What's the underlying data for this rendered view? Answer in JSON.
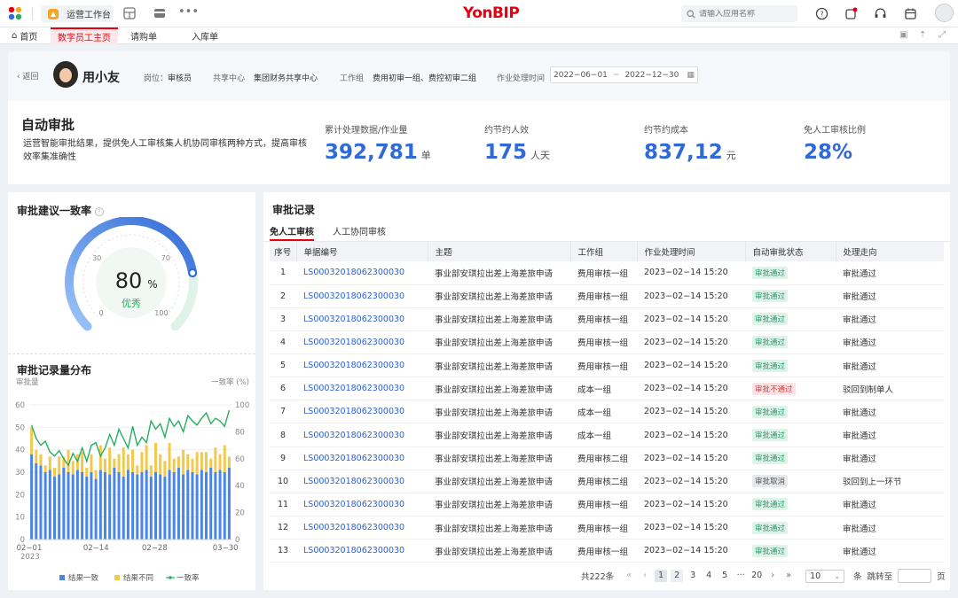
{
  "topbar": {
    "workspace_label": "运营工作台",
    "brand": "YonBIP",
    "search_placeholder": "请输入应用名称",
    "colors": {
      "brand": "#e60012",
      "accent": "#2f6ad6"
    }
  },
  "tabs": [
    {
      "label": "首页",
      "icon": "home-icon"
    },
    {
      "label": "数字员工主页",
      "active": true
    },
    {
      "label": "请购单"
    },
    {
      "label": "入库单"
    }
  ],
  "profile": {
    "back_label": "返回",
    "name": "用小友",
    "post_label": "岗位：",
    "post_value": "审核员",
    "center_label": "共享中心",
    "center_value": "集团财务共享中心",
    "group_label": "工作组",
    "group_value": "费用初审一组、费控初审二组",
    "time_label": "作业处理时间",
    "date_from": "2022−06−01",
    "date_to": "2022−12−30"
  },
  "kpi": {
    "title": "自动审批",
    "description": "运营智能审批结果，提供免人工审核集人机协同审核两种方式，提高审核效率集准确性",
    "items": [
      {
        "label": "累计处理数据/作业量",
        "value": "392,781",
        "unit": "单"
      },
      {
        "label": "约节约人效",
        "value": "175",
        "unit": "人天"
      },
      {
        "label": "约节约成本",
        "value": "837,12",
        "unit": "元"
      },
      {
        "label": "免人工审核比例",
        "value": "28%",
        "unit": ""
      }
    ]
  },
  "gauge": {
    "title": "审批建议一致率",
    "value": "80",
    "percent_sign": "%",
    "rating": "优秀",
    "level": 0.8,
    "ticks": [
      "0",
      "30",
      "70",
      "100"
    ]
  },
  "chart_data": {
    "type": "bar",
    "title": "审批记录量分布",
    "ylabel": "审批量",
    "y2label": "一致率",
    "y2unit": "(%)",
    "ylim": [
      0,
      60
    ],
    "y2lim": [
      0,
      100
    ],
    "yticks": [
      "0",
      "10",
      "20",
      "30",
      "40",
      "50",
      "60"
    ],
    "y2ticks": [
      "0",
      "20",
      "40",
      "60",
      "80",
      "100"
    ],
    "x_tick_labels": [
      "02−01",
      "02−14",
      "02−28",
      "03−30"
    ],
    "x_year": "2023",
    "stacked": true,
    "series": [
      {
        "name": "结果一致",
        "kind": "bar",
        "color": "#4a86e8",
        "values": [
          38,
          34,
          33,
          30,
          31,
          28,
          29,
          32,
          30,
          29,
          31,
          30,
          28,
          30,
          27,
          31,
          30,
          29,
          32,
          30,
          28,
          31,
          30,
          29,
          30,
          31,
          28,
          30,
          29,
          28,
          31,
          30,
          32,
          29,
          31,
          30,
          29,
          31,
          30,
          32,
          30,
          31,
          30,
          32
        ]
      },
      {
        "name": "结果不同",
        "kind": "bar",
        "color": "#f2c94c",
        "values": [
          12,
          6,
          5,
          3,
          6,
          4,
          8,
          5,
          10,
          6,
          7,
          9,
          4,
          8,
          4,
          11,
          6,
          12,
          4,
          8,
          13,
          7,
          10,
          4,
          9,
          11,
          5,
          13,
          9,
          7,
          12,
          6,
          5,
          11,
          7,
          6,
          10,
          8,
          9,
          4,
          11,
          7,
          12,
          5
        ]
      },
      {
        "name": "一致率",
        "kind": "line",
        "color": "#27ae60",
        "values": [
          85,
          75,
          70,
          73,
          65,
          62,
          66,
          60,
          55,
          64,
          58,
          68,
          58,
          70,
          72,
          62,
          68,
          78,
          70,
          82,
          75,
          68,
          84,
          70,
          76,
          72,
          88,
          82,
          86,
          76,
          90,
          84,
          88,
          80,
          92,
          88,
          85,
          90,
          94,
          86,
          90,
          88,
          84,
          96
        ]
      }
    ],
    "legend_position": "bottom"
  },
  "records": {
    "title": "审批记录",
    "subtabs": [
      "免人工审核",
      "人工协同审核"
    ],
    "columns": [
      "序号",
      "单据编号",
      "主题",
      "工作组",
      "作业处理时间",
      "自动审批状态",
      "处理走向"
    ],
    "rows": [
      {
        "idx": "1",
        "code": "LS00032018062300030",
        "subject": "事业部安琪拉出差上海差旅申请",
        "group": "费用审核一组",
        "time": "2023−02−14 15:20",
        "status": "审批通过",
        "status_type": "pass",
        "flow": "审批通过"
      },
      {
        "idx": "2",
        "code": "LS00032018062300030",
        "subject": "事业部安琪拉出差上海差旅申请",
        "group": "费用审核一组",
        "time": "2023−02−14 15:20",
        "status": "审批通过",
        "status_type": "pass",
        "flow": "审批通过"
      },
      {
        "idx": "3",
        "code": "LS00032018062300030",
        "subject": "事业部安琪拉出差上海差旅申请",
        "group": "费用审核一组",
        "time": "2023−02−14 15:20",
        "status": "审批通过",
        "status_type": "pass",
        "flow": "审批通过"
      },
      {
        "idx": "4",
        "code": "LS00032018062300030",
        "subject": "事业部安琪拉出差上海差旅申请",
        "group": "费用审核一组",
        "time": "2023−02−14 15:20",
        "status": "审批通过",
        "status_type": "pass",
        "flow": "审批通过"
      },
      {
        "idx": "5",
        "code": "LS00032018062300030",
        "subject": "事业部安琪拉出差上海差旅申请",
        "group": "费用审核一组",
        "time": "2023−02−14 15:20",
        "status": "审批通过",
        "status_type": "pass",
        "flow": "审批通过"
      },
      {
        "idx": "6",
        "code": "LS00032018062300030",
        "subject": "事业部安琪拉出差上海差旅申请",
        "group": "成本一组",
        "time": "2023−02−14 15:20",
        "status": "审批不通过",
        "status_type": "fail",
        "flow": "驳回到制单人"
      },
      {
        "idx": "7",
        "code": "LS00032018062300030",
        "subject": "事业部安琪拉出差上海差旅申请",
        "group": "成本一组",
        "time": "2023−02−14 15:20",
        "status": "审批通过",
        "status_type": "pass",
        "flow": "审批通过"
      },
      {
        "idx": "8",
        "code": "LS00032018062300030",
        "subject": "事业部安琪拉出差上海差旅申请",
        "group": "成本一组",
        "time": "2023−02−14 15:20",
        "status": "审批通过",
        "status_type": "pass",
        "flow": "审批通过"
      },
      {
        "idx": "9",
        "code": "LS00032018062300030",
        "subject": "事业部安琪拉出差上海差旅申请",
        "group": "费用审核二组",
        "time": "2023−02−14 15:20",
        "status": "审批通过",
        "status_type": "pass",
        "flow": "审批通过"
      },
      {
        "idx": "10",
        "code": "LS00032018062300030",
        "subject": "事业部安琪拉出差上海差旅申请",
        "group": "费用审核二组",
        "time": "2023−02−14 15:20",
        "status": "审批取消",
        "status_type": "cancel",
        "flow": "驳回到上一环节"
      },
      {
        "idx": "11",
        "code": "LS00032018062300030",
        "subject": "事业部安琪拉出差上海差旅申请",
        "group": "费用审核一组",
        "time": "2023−02−14 15:20",
        "status": "审批通过",
        "status_type": "pass",
        "flow": "审批通过"
      },
      {
        "idx": "12",
        "code": "LS00032018062300030",
        "subject": "事业部安琪拉出差上海差旅申请",
        "group": "费用审核一组",
        "time": "2023−02−14 15:20",
        "status": "审批通过",
        "status_type": "pass",
        "flow": "审批通过"
      },
      {
        "idx": "13",
        "code": "LS00032018062300030",
        "subject": "事业部安琪拉出差上海差旅申请",
        "group": "费用审核一组",
        "time": "2023−02−14 15:20",
        "status": "审批通过",
        "status_type": "pass",
        "flow": "审批通过"
      }
    ]
  },
  "pagination": {
    "total": "共222条",
    "pages": [
      "1",
      "2",
      "3",
      "4",
      "5",
      "···",
      "20"
    ],
    "current_page": 1,
    "page_size": "10",
    "page_size_unit": "条",
    "jump_label": "跳转至",
    "page_unit": "页"
  }
}
